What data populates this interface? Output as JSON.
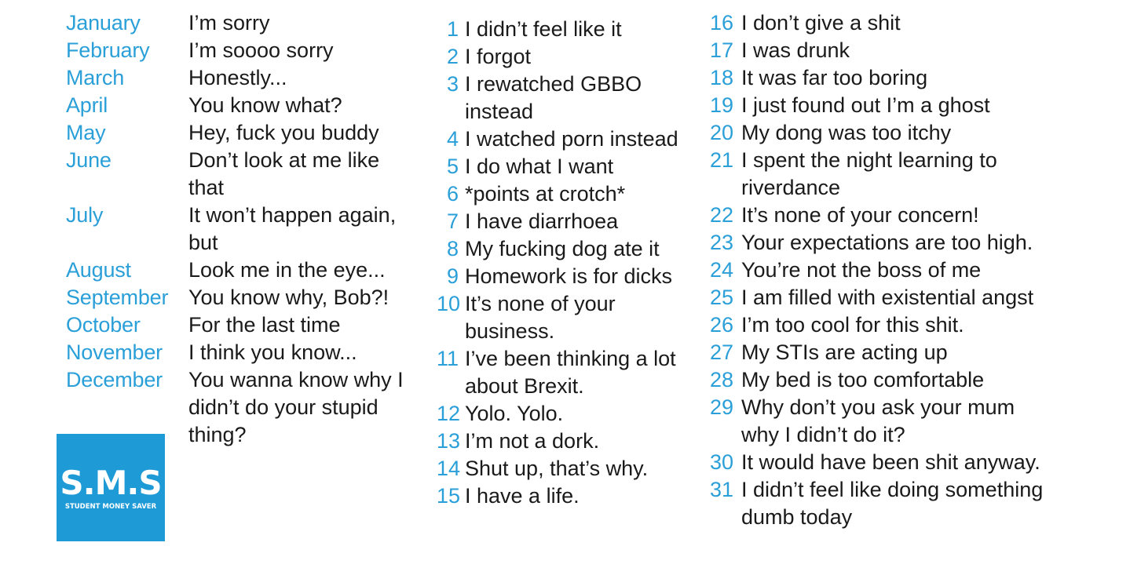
{
  "months": [
    {
      "month": "January",
      "excuse": "I’m sorry"
    },
    {
      "month": "February",
      "excuse": "I’m soooo sorry"
    },
    {
      "month": "March",
      "excuse": "Honestly..."
    },
    {
      "month": "April",
      "excuse": "You know what?"
    },
    {
      "month": "May",
      "excuse": "Hey, fuck you buddy"
    },
    {
      "month": "June",
      "excuse": "Don’t look at me like that"
    },
    {
      "month": "July",
      "excuse": "It won’t happen again, but"
    },
    {
      "month": "August",
      "excuse": "Look me in the eye..."
    },
    {
      "month": "September",
      "excuse": "You know why, Bob?!"
    },
    {
      "month": "October",
      "excuse": "For the last time"
    },
    {
      "month": "November",
      "excuse": "I think you know..."
    },
    {
      "month": "December",
      "excuse": "You wanna know why I didn’t do your stupid thing?"
    }
  ],
  "days_a": [
    {
      "num": "1",
      "text": "I didn’t feel like it"
    },
    {
      "num": "2",
      "text": "I forgot"
    },
    {
      "num": "3",
      "text": "I rewatched GBBO instead"
    },
    {
      "num": "4",
      "text": "I watched porn instead"
    },
    {
      "num": "5",
      "text": "I do what I want"
    },
    {
      "num": "6",
      "text": "*points at crotch*"
    },
    {
      "num": "7",
      "text": "I have diarrhoea"
    },
    {
      "num": "8",
      "text": "My fucking dog ate it"
    },
    {
      "num": "9",
      "text": "Homework is for dicks"
    },
    {
      "num": "10",
      "text": "It’s none of your business."
    },
    {
      "num": "11",
      "text": "I’ve been thinking a lot about Brexit."
    },
    {
      "num": "12",
      "text": "Yolo. Yolo."
    },
    {
      "num": "13",
      "text": "I’m not a dork."
    },
    {
      "num": "14",
      "text": "Shut up, that’s why."
    },
    {
      "num": "15",
      "text": "I have a life."
    }
  ],
  "days_b": [
    {
      "num": "16",
      "text": "I don’t give a shit"
    },
    {
      "num": "17",
      "text": "I was drunk"
    },
    {
      "num": "18",
      "text": "It was far too boring"
    },
    {
      "num": "19",
      "text": "I just found out I’m a ghost"
    },
    {
      "num": "20",
      "text": "My dong was too itchy"
    },
    {
      "num": "21",
      "text": "I spent the night learning to riverdance"
    },
    {
      "num": "22",
      "text": "It’s none of your concern!"
    },
    {
      "num": "23",
      "text": "Your expectations are too high."
    },
    {
      "num": "24",
      "text": "You’re not the boss of me"
    },
    {
      "num": "25",
      "text": "I am filled with existential angst"
    },
    {
      "num": "26",
      "text": "I’m too cool for this shit."
    },
    {
      "num": "27",
      "text": "My STIs are acting up"
    },
    {
      "num": "28",
      "text": "My bed is too comfortable"
    },
    {
      "num": "29",
      "text": "Why don’t you ask your mum why I didn’t do it?"
    },
    {
      "num": "30",
      "text": "It would have been shit anyway."
    },
    {
      "num": "31",
      "text": "I didn’t feel like doing something dumb today"
    }
  ],
  "logo": {
    "main": "S.M.S",
    "sub": "STUDENT MONEY SAVER"
  },
  "colors": {
    "accent": "#2a9fd8",
    "logo_bg": "#1e9ad6",
    "text": "#1a1a1a"
  }
}
